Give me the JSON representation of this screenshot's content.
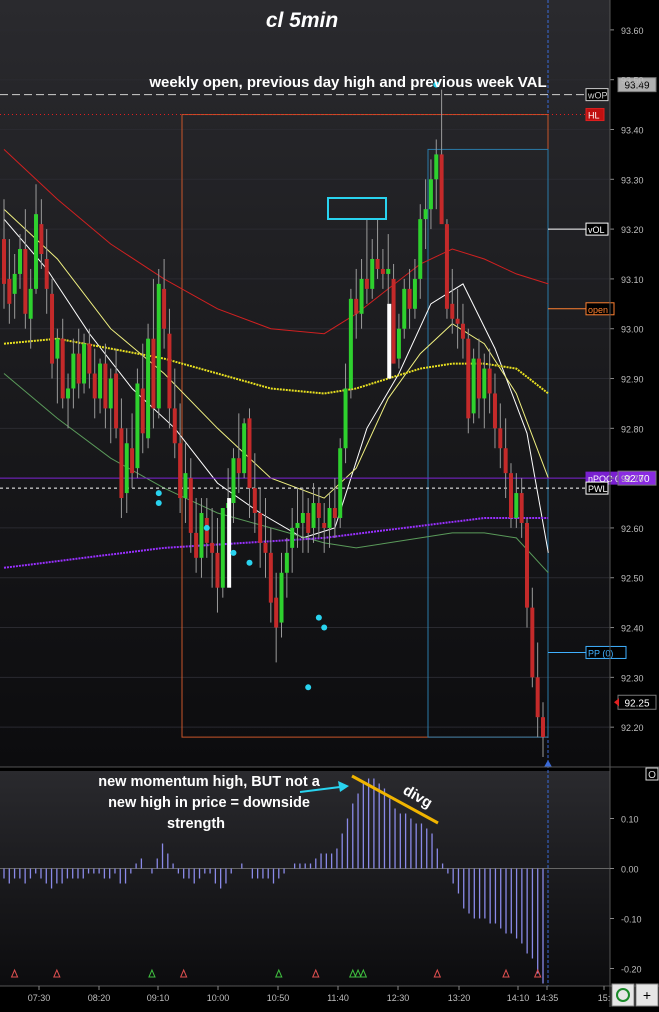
{
  "chart_data": {
    "type": "candlestick",
    "title": "cl 5min",
    "x_tick_labels": [
      "07:30",
      "08:20",
      "09:10",
      "10:00",
      "10:50",
      "11:40",
      "12:30",
      "13:20",
      "14:10",
      "14:35",
      "15:"
    ],
    "price_ticks": [
      "93.60",
      "93.50",
      "93.40",
      "93.30",
      "93.20",
      "93.10",
      "93.00",
      "92.90",
      "92.80",
      "92.70",
      "92.60",
      "92.50",
      "92.40",
      "92.30",
      "92.20"
    ],
    "ylim": [
      92.12,
      93.66
    ],
    "candles": [
      {
        "o": 93.18,
        "h": 93.26,
        "l": 93.04,
        "c": 93.09
      },
      {
        "o": 93.1,
        "h": 93.18,
        "l": 93.01,
        "c": 93.05
      },
      {
        "o": 93.07,
        "h": 93.15,
        "l": 93.02,
        "c": 93.11
      },
      {
        "o": 93.11,
        "h": 93.19,
        "l": 93.08,
        "c": 93.16
      },
      {
        "o": 93.16,
        "h": 93.24,
        "l": 93.0,
        "c": 93.03
      },
      {
        "o": 93.02,
        "h": 93.12,
        "l": 92.96,
        "c": 93.08
      },
      {
        "o": 93.08,
        "h": 93.29,
        "l": 93.07,
        "c": 93.23
      },
      {
        "o": 93.21,
        "h": 93.26,
        "l": 93.12,
        "c": 93.15
      },
      {
        "o": 93.14,
        "h": 93.2,
        "l": 93.03,
        "c": 93.08
      },
      {
        "o": 93.07,
        "h": 93.1,
        "l": 92.9,
        "c": 92.93
      },
      {
        "o": 92.94,
        "h": 93.0,
        "l": 92.85,
        "c": 92.98
      },
      {
        "o": 92.98,
        "h": 93.02,
        "l": 92.84,
        "c": 92.86
      },
      {
        "o": 92.86,
        "h": 92.91,
        "l": 92.8,
        "c": 92.88
      },
      {
        "o": 92.88,
        "h": 92.98,
        "l": 92.84,
        "c": 92.95
      },
      {
        "o": 92.95,
        "h": 93.0,
        "l": 92.86,
        "c": 92.89
      },
      {
        "o": 92.89,
        "h": 92.99,
        "l": 92.87,
        "c": 92.97
      },
      {
        "o": 92.97,
        "h": 93.0,
        "l": 92.88,
        "c": 92.91
      },
      {
        "o": 92.91,
        "h": 92.96,
        "l": 92.82,
        "c": 92.86
      },
      {
        "o": 92.86,
        "h": 92.94,
        "l": 92.83,
        "c": 92.93
      },
      {
        "o": 92.93,
        "h": 92.97,
        "l": 92.8,
        "c": 92.84
      },
      {
        "o": 92.84,
        "h": 92.92,
        "l": 92.77,
        "c": 92.9
      },
      {
        "o": 92.91,
        "h": 92.96,
        "l": 92.78,
        "c": 92.8
      },
      {
        "o": 92.8,
        "h": 92.86,
        "l": 92.62,
        "c": 92.66
      },
      {
        "o": 92.67,
        "h": 92.8,
        "l": 92.63,
        "c": 92.77
      },
      {
        "o": 92.76,
        "h": 92.83,
        "l": 92.68,
        "c": 92.71
      },
      {
        "o": 92.72,
        "h": 92.92,
        "l": 92.7,
        "c": 92.89
      },
      {
        "o": 92.88,
        "h": 92.97,
        "l": 92.75,
        "c": 92.79
      },
      {
        "o": 92.78,
        "h": 93.01,
        "l": 92.76,
        "c": 92.98
      },
      {
        "o": 92.98,
        "h": 93.1,
        "l": 92.8,
        "c": 92.84
      },
      {
        "o": 92.84,
        "h": 93.12,
        "l": 92.82,
        "c": 93.09
      },
      {
        "o": 93.08,
        "h": 93.14,
        "l": 92.96,
        "c": 93.0
      },
      {
        "o": 92.99,
        "h": 93.04,
        "l": 92.8,
        "c": 92.84
      },
      {
        "o": 92.84,
        "h": 92.92,
        "l": 92.74,
        "c": 92.77
      },
      {
        "o": 92.77,
        "h": 92.85,
        "l": 92.63,
        "c": 92.66
      },
      {
        "o": 92.66,
        "h": 92.77,
        "l": 92.61,
        "c": 92.71
      },
      {
        "o": 92.7,
        "h": 92.74,
        "l": 92.55,
        "c": 92.59
      },
      {
        "o": 92.59,
        "h": 92.66,
        "l": 92.51,
        "c": 92.54
      },
      {
        "o": 92.54,
        "h": 92.66,
        "l": 92.5,
        "c": 92.63
      },
      {
        "o": 92.62,
        "h": 92.66,
        "l": 92.54,
        "c": 92.57
      },
      {
        "o": 92.57,
        "h": 92.64,
        "l": 92.48,
        "c": 92.55
      },
      {
        "o": 92.55,
        "h": 92.62,
        "l": 92.43,
        "c": 92.48
      },
      {
        "o": 92.48,
        "h": 92.64,
        "l": 92.46,
        "c": 92.64
      },
      {
        "o": 92.64,
        "h": 92.72,
        "l": 92.58,
        "c": 92.65
      },
      {
        "o": 92.65,
        "h": 92.76,
        "l": 92.61,
        "c": 92.74
      },
      {
        "o": 92.74,
        "h": 92.83,
        "l": 92.67,
        "c": 92.71
      },
      {
        "o": 92.71,
        "h": 92.82,
        "l": 92.7,
        "c": 92.81
      },
      {
        "o": 92.82,
        "h": 92.84,
        "l": 92.62,
        "c": 92.68
      },
      {
        "o": 92.68,
        "h": 92.75,
        "l": 92.59,
        "c": 92.63
      },
      {
        "o": 92.63,
        "h": 92.68,
        "l": 92.52,
        "c": 92.57
      },
      {
        "o": 92.57,
        "h": 92.66,
        "l": 92.5,
        "c": 92.55
      },
      {
        "o": 92.55,
        "h": 92.6,
        "l": 92.41,
        "c": 92.45
      },
      {
        "o": 92.46,
        "h": 92.51,
        "l": 92.33,
        "c": 92.4
      },
      {
        "o": 92.41,
        "h": 92.55,
        "l": 92.38,
        "c": 92.51
      },
      {
        "o": 92.51,
        "h": 92.58,
        "l": 92.46,
        "c": 92.55
      },
      {
        "o": 92.56,
        "h": 92.64,
        "l": 92.51,
        "c": 92.6
      },
      {
        "o": 92.6,
        "h": 92.68,
        "l": 92.56,
        "c": 92.61
      },
      {
        "o": 92.61,
        "h": 92.68,
        "l": 92.55,
        "c": 92.63
      },
      {
        "o": 92.63,
        "h": 92.66,
        "l": 92.55,
        "c": 92.59
      },
      {
        "o": 92.6,
        "h": 92.69,
        "l": 92.57,
        "c": 92.65
      },
      {
        "o": 92.65,
        "h": 92.68,
        "l": 92.58,
        "c": 92.62
      },
      {
        "o": 92.61,
        "h": 92.65,
        "l": 92.55,
        "c": 92.6
      },
      {
        "o": 92.6,
        "h": 92.67,
        "l": 92.56,
        "c": 92.64
      },
      {
        "o": 92.64,
        "h": 92.7,
        "l": 92.58,
        "c": 92.62
      },
      {
        "o": 92.62,
        "h": 92.78,
        "l": 92.6,
        "c": 92.76
      },
      {
        "o": 92.76,
        "h": 92.93,
        "l": 92.73,
        "c": 92.88
      },
      {
        "o": 92.88,
        "h": 93.08,
        "l": 92.86,
        "c": 93.06
      },
      {
        "o": 93.06,
        "h": 93.12,
        "l": 92.98,
        "c": 93.03
      },
      {
        "o": 93.03,
        "h": 93.14,
        "l": 93.0,
        "c": 93.1
      },
      {
        "o": 93.1,
        "h": 93.22,
        "l": 93.05,
        "c": 93.08
      },
      {
        "o": 93.08,
        "h": 93.18,
        "l": 93.06,
        "c": 93.14
      },
      {
        "o": 93.14,
        "h": 93.22,
        "l": 93.1,
        "c": 93.12
      },
      {
        "o": 93.12,
        "h": 93.16,
        "l": 93.08,
        "c": 93.11
      },
      {
        "o": 93.11,
        "h": 93.19,
        "l": 93.05,
        "c": 93.12
      },
      {
        "o": 93.1,
        "h": 93.13,
        "l": 92.93,
        "c": 92.93
      },
      {
        "o": 92.94,
        "h": 93.03,
        "l": 92.92,
        "c": 93.0
      },
      {
        "o": 93.0,
        "h": 93.1,
        "l": 92.98,
        "c": 93.08
      },
      {
        "o": 93.08,
        "h": 93.12,
        "l": 93.0,
        "c": 93.04
      },
      {
        "o": 93.04,
        "h": 93.14,
        "l": 93.02,
        "c": 93.1
      },
      {
        "o": 93.1,
        "h": 93.25,
        "l": 93.06,
        "c": 93.22
      },
      {
        "o": 93.22,
        "h": 93.3,
        "l": 93.16,
        "c": 93.24
      },
      {
        "o": 93.24,
        "h": 93.34,
        "l": 93.2,
        "c": 93.3
      },
      {
        "o": 93.3,
        "h": 93.38,
        "l": 93.24,
        "c": 93.35
      },
      {
        "o": 93.35,
        "h": 93.48,
        "l": 93.28,
        "c": 93.21
      },
      {
        "o": 93.21,
        "h": 93.22,
        "l": 93.02,
        "c": 93.04
      },
      {
        "o": 93.05,
        "h": 93.12,
        "l": 92.99,
        "c": 93.02
      },
      {
        "o": 93.02,
        "h": 93.08,
        "l": 92.96,
        "c": 93.01
      },
      {
        "o": 93.01,
        "h": 93.05,
        "l": 92.94,
        "c": 92.98
      },
      {
        "o": 92.98,
        "h": 93.0,
        "l": 92.79,
        "c": 92.82
      },
      {
        "o": 92.83,
        "h": 92.96,
        "l": 92.81,
        "c": 92.94
      },
      {
        "o": 92.94,
        "h": 92.98,
        "l": 92.82,
        "c": 92.86
      },
      {
        "o": 92.86,
        "h": 92.95,
        "l": 92.8,
        "c": 92.92
      },
      {
        "o": 92.92,
        "h": 92.96,
        "l": 92.83,
        "c": 92.87
      },
      {
        "o": 92.87,
        "h": 92.91,
        "l": 92.76,
        "c": 92.8
      },
      {
        "o": 92.8,
        "h": 92.85,
        "l": 92.72,
        "c": 92.76
      },
      {
        "o": 92.76,
        "h": 92.82,
        "l": 92.66,
        "c": 92.71
      },
      {
        "o": 92.71,
        "h": 92.73,
        "l": 92.6,
        "c": 92.62
      },
      {
        "o": 92.62,
        "h": 92.71,
        "l": 92.6,
        "c": 92.67
      },
      {
        "o": 92.67,
        "h": 92.7,
        "l": 92.58,
        "c": 92.61
      },
      {
        "o": 92.61,
        "h": 92.62,
        "l": 92.4,
        "c": 92.44
      },
      {
        "o": 92.44,
        "h": 92.48,
        "l": 92.28,
        "c": 92.3
      },
      {
        "o": 92.3,
        "h": 92.37,
        "l": 92.18,
        "c": 92.22
      },
      {
        "o": 92.22,
        "h": 92.25,
        "l": 92.14,
        "c": 92.18
      }
    ],
    "moving_averages": [
      {
        "color": "#ffffff",
        "points": [
          [
            0,
            93.22
          ],
          [
            8,
            93.12
          ],
          [
            16,
            92.99
          ],
          [
            24,
            92.88
          ],
          [
            32,
            92.8
          ],
          [
            40,
            92.69
          ],
          [
            48,
            92.63
          ],
          [
            56,
            92.58
          ],
          [
            62,
            92.6
          ],
          [
            68,
            92.8
          ],
          [
            74,
            92.91
          ],
          [
            80,
            93.05
          ],
          [
            86,
            93.09
          ],
          [
            92,
            92.96
          ],
          [
            98,
            92.79
          ],
          [
            102,
            92.55
          ]
        ]
      },
      {
        "color": "#f0f080",
        "points": [
          [
            0,
            93.24
          ],
          [
            10,
            93.14
          ],
          [
            20,
            93.0
          ],
          [
            30,
            92.91
          ],
          [
            40,
            92.8
          ],
          [
            50,
            92.7
          ],
          [
            60,
            92.66
          ],
          [
            66,
            92.72
          ],
          [
            72,
            92.86
          ],
          [
            78,
            92.95
          ],
          [
            84,
            93.01
          ],
          [
            90,
            92.97
          ],
          [
            96,
            92.87
          ],
          [
            102,
            92.7
          ]
        ]
      },
      {
        "color": "#d02020",
        "points": [
          [
            0,
            93.36
          ],
          [
            10,
            93.26
          ],
          [
            20,
            93.17
          ],
          [
            30,
            93.1
          ],
          [
            40,
            93.04
          ],
          [
            50,
            93.0
          ],
          [
            60,
            92.99
          ],
          [
            66,
            93.03
          ],
          [
            72,
            93.08
          ],
          [
            78,
            93.13
          ],
          [
            84,
            93.16
          ],
          [
            90,
            93.14
          ],
          [
            96,
            93.11
          ],
          [
            102,
            93.09
          ]
        ]
      },
      {
        "color": "#e8e020",
        "points": [
          [
            0,
            92.97
          ],
          [
            10,
            92.98
          ],
          [
            20,
            92.96
          ],
          [
            30,
            92.94
          ],
          [
            40,
            92.91
          ],
          [
            50,
            92.88
          ],
          [
            60,
            92.87
          ],
          [
            66,
            92.88
          ],
          [
            72,
            92.9
          ],
          [
            78,
            92.92
          ],
          [
            84,
            92.93
          ],
          [
            90,
            92.93
          ],
          [
            96,
            92.92
          ],
          [
            102,
            92.87
          ]
        ]
      },
      {
        "color": "#5a9a5a",
        "points": [
          [
            0,
            92.91
          ],
          [
            10,
            92.82
          ],
          [
            20,
            92.74
          ],
          [
            30,
            92.68
          ],
          [
            40,
            92.63
          ],
          [
            50,
            92.6
          ],
          [
            60,
            92.57
          ],
          [
            66,
            92.56
          ],
          [
            72,
            92.57
          ],
          [
            78,
            92.58
          ],
          [
            84,
            92.59
          ],
          [
            90,
            92.59
          ],
          [
            96,
            92.58
          ],
          [
            102,
            92.51
          ]
        ]
      },
      {
        "color": "#9930ff",
        "points": [
          [
            0,
            92.52
          ],
          [
            15,
            92.54
          ],
          [
            30,
            92.56
          ],
          [
            45,
            92.57
          ],
          [
            60,
            92.58
          ],
          [
            75,
            92.6
          ],
          [
            90,
            92.62
          ],
          [
            102,
            92.62
          ]
        ]
      }
    ],
    "reference_lines": [
      {
        "label": "wOP",
        "price": 93.47,
        "color": "#cfcfcf"
      },
      {
        "label": "HL",
        "price": 93.43,
        "color": "#e02020"
      },
      {
        "label": "vOL",
        "price": 93.2,
        "color": "#ffffff"
      },
      {
        "label": "open",
        "price": 93.04,
        "color": "#ff8030"
      },
      {
        "label": "nPOC 09/07",
        "price": 92.7,
        "color": "#7a20d0"
      },
      {
        "label": "PWL",
        "price": 92.68,
        "color": "#ffffff"
      },
      {
        "label": "PP (0)",
        "price": 92.35,
        "color": "#40b0ff"
      }
    ],
    "price_labels": [
      {
        "text": "93.49",
        "price": 93.49,
        "bg": "#b0b0b0",
        "fg": "#000000"
      },
      {
        "text": "92.70",
        "price": 92.7,
        "bg": "#8a2be2",
        "fg": "#ffffff"
      },
      {
        "text": "92.25",
        "price": 92.25,
        "bg": "#000000",
        "fg": "#ffffff"
      }
    ],
    "dots": [
      [
        38,
        92.6
      ],
      [
        43,
        92.55
      ],
      [
        46,
        92.53
      ],
      [
        59,
        92.42
      ],
      [
        60,
        92.4
      ],
      [
        57,
        92.28
      ],
      [
        81,
        93.49
      ],
      [
        29,
        92.67
      ],
      [
        29,
        92.65
      ]
    ],
    "annotations": [
      "weekly open, previous day high and previous week VAL",
      "new momentum high, BUT not a",
      "new high in price = downside",
      "strength",
      "divg"
    ],
    "indicator": {
      "ticks": [
        "0.10",
        "0.00",
        "-0.10",
        "-0.20"
      ],
      "ylim": [
        -0.235,
        0.195
      ],
      "values": [
        -0.02,
        -0.03,
        -0.02,
        -0.02,
        -0.03,
        -0.02,
        -0.01,
        -0.02,
        -0.03,
        -0.04,
        -0.03,
        -0.03,
        -0.02,
        -0.02,
        -0.02,
        -0.02,
        -0.01,
        -0.01,
        -0.01,
        -0.02,
        -0.02,
        -0.01,
        -0.03,
        -0.03,
        -0.01,
        0.01,
        0.02,
        0.0,
        -0.01,
        0.02,
        0.05,
        0.03,
        0.01,
        -0.01,
        -0.02,
        -0.02,
        -0.03,
        -0.02,
        -0.01,
        -0.01,
        -0.03,
        -0.04,
        -0.03,
        -0.01,
        0.0,
        0.01,
        0.0,
        -0.02,
        -0.02,
        -0.02,
        -0.02,
        -0.03,
        -0.02,
        -0.01,
        0.0,
        0.01,
        0.01,
        0.01,
        0.01,
        0.02,
        0.03,
        0.03,
        0.03,
        0.04,
        0.07,
        0.1,
        0.13,
        0.15,
        0.17,
        0.18,
        0.18,
        0.17,
        0.16,
        0.14,
        0.12,
        0.11,
        0.11,
        0.1,
        0.09,
        0.09,
        0.08,
        0.07,
        0.04,
        0.01,
        -0.01,
        -0.03,
        -0.05,
        -0.08,
        -0.09,
        -0.1,
        -0.1,
        -0.1,
        -0.11,
        -0.11,
        -0.12,
        -0.13,
        -0.13,
        -0.14,
        -0.15,
        -0.17,
        -0.18,
        -0.21,
        -0.23
      ]
    }
  },
  "colors": {
    "up": "#2ed12e",
    "down": "#c42a2a",
    "wick": "#9a9a9a",
    "grid": "#2a2a30",
    "text": "#dcdcdc",
    "cyan": "#29d3ef",
    "divg": "#f0b400"
  },
  "controls": {
    "refresh_icon": "refresh-icon",
    "add_label": "+"
  }
}
